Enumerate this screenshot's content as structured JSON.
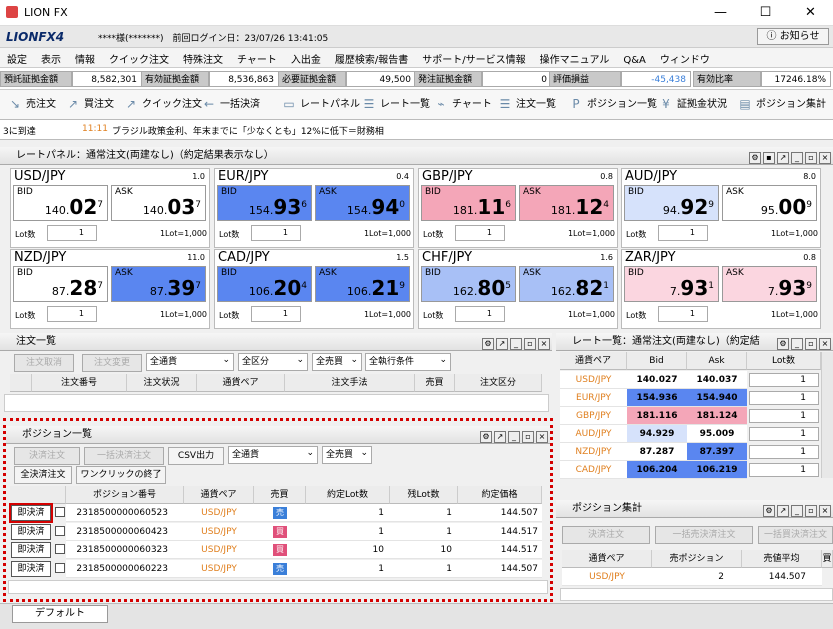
{
  "window": {
    "title": "LION FX"
  },
  "header": {
    "logo": "LIONFX4",
    "user": "****様(*******)　前回ログイン日：23/07/26 13:41:05",
    "notice": "お知らせ"
  },
  "menu": [
    "設定",
    "表示",
    "情報",
    "クイック注文",
    "特殊注文",
    "チャート",
    "入出金",
    "履歴検索/報告書",
    "サポート/サービス情報",
    "操作マニュアル",
    "Q&A",
    "ウィンドウ"
  ],
  "info": [
    {
      "label": "預託証拠金額",
      "value": "8,582,301"
    },
    {
      "label": "有効証拠金額",
      "value": "8,536,863"
    },
    {
      "label": "必要証拠金額",
      "value": "49,500"
    },
    {
      "label": "発注証拠金額",
      "value": "0"
    },
    {
      "label": "評価損益",
      "value": "-45,438"
    },
    {
      "label": "有効比率",
      "value": "17246.18%"
    }
  ],
  "toolbar": [
    "売注文",
    "買注文",
    "クイック注文",
    "一括決済",
    "レートパネル",
    "レート一覧",
    "チャート",
    "注文一覧",
    "ポジション一覧",
    "証拠金状況",
    "ポジション集計"
  ],
  "news": {
    "prefix": "3に到達",
    "time": "11:11",
    "text": "ブラジル政策金利、年末までに「少なくとも」12%に低下＝財務相"
  },
  "rate_panel": {
    "title": "レートパネル：通常注文(両建なし)（約定結果表示なし）",
    "lot_label": "Lot数",
    "lot_value": "1",
    "lot_unit": "1Lot=1,000",
    "bid": "BID",
    "ask": "ASK",
    "pairs": [
      {
        "pair": "USD/JPY",
        "spread": "1.0",
        "bid_a": "140.",
        "bid_b": "02",
        "bid_c": "7",
        "ask_a": "140.",
        "ask_b": "03",
        "ask_c": "7",
        "bid_color": "#ffffff",
        "ask_color": "#ffffff"
      },
      {
        "pair": "EUR/JPY",
        "spread": "0.4",
        "bid_a": "154.",
        "bid_b": "93",
        "bid_c": "6",
        "ask_a": "154.",
        "ask_b": "94",
        "ask_c": "0",
        "bid_color": "#5a86f0",
        "ask_color": "#5a86f0"
      },
      {
        "pair": "GBP/JPY",
        "spread": "0.8",
        "bid_a": "181.",
        "bid_b": "11",
        "bid_c": "6",
        "ask_a": "181.",
        "ask_b": "12",
        "ask_c": "4",
        "bid_color": "#f4a6b8",
        "ask_color": "#f4a6b8"
      },
      {
        "pair": "AUD/JPY",
        "spread": "8.0",
        "bid_a": "94.",
        "bid_b": "92",
        "bid_c": "9",
        "ask_a": "95.",
        "ask_b": "00",
        "ask_c": "9",
        "bid_color": "#d6e2fb",
        "ask_color": "#ffffff"
      },
      {
        "pair": "NZD/JPY",
        "spread": "11.0",
        "bid_a": "87.",
        "bid_b": "28",
        "bid_c": "7",
        "ask_a": "87.",
        "ask_b": "39",
        "ask_c": "7",
        "bid_color": "#ffffff",
        "ask_color": "#5a86f0"
      },
      {
        "pair": "CAD/JPY",
        "spread": "1.5",
        "bid_a": "106.",
        "bid_b": "20",
        "bid_c": "4",
        "ask_a": "106.",
        "ask_b": "21",
        "ask_c": "9",
        "bid_color": "#5a86f0",
        "ask_color": "#5a86f0"
      },
      {
        "pair": "CHF/JPY",
        "spread": "1.6",
        "bid_a": "162.",
        "bid_b": "80",
        "bid_c": "5",
        "ask_a": "162.",
        "ask_b": "82",
        "ask_c": "1",
        "bid_color": "#a8c0f6",
        "ask_color": "#a8c0f6"
      },
      {
        "pair": "ZAR/JPY",
        "spread": "0.8",
        "bid_a": "7.",
        "bid_b": "93",
        "bid_c": "1",
        "ask_a": "7.",
        "ask_b": "93",
        "ask_c": "9",
        "bid_color": "#fbd6e0",
        "ask_color": "#fbd6e0"
      }
    ]
  },
  "order_list": {
    "title": "注文一覧",
    "cancel": "注文取消",
    "change": "注文変更",
    "filters": [
      "全通貨",
      "全区分",
      "全売買",
      "全執行条件"
    ],
    "columns": [
      "注文番号",
      "注文状況",
      "通貨ペア",
      "注文手法",
      "売買",
      "注文区分"
    ]
  },
  "position_list": {
    "title": "ポジション一覧",
    "settle_order": "決済注文",
    "bulk_settle": "一括決済注文",
    "csv": "CSV出力",
    "currency": "全通貨",
    "side": "全売買",
    "all_settle": "全決済注文",
    "one_click_end": "ワンクリックの終了",
    "columns": [
      "ポジション番号",
      "通貨ペア",
      "売買",
      "約定Lot数",
      "残Lot数",
      "約定価格"
    ],
    "settle_btn": "即決済",
    "rows": [
      {
        "id": "2318500000060523",
        "pair": "USD/JPY",
        "side": "売",
        "lot": "1",
        "rest": "1",
        "price": "144.507"
      },
      {
        "id": "2318500000060423",
        "pair": "USD/JPY",
        "side": "買",
        "lot": "1",
        "rest": "1",
        "price": "144.517"
      },
      {
        "id": "2318500000060323",
        "pair": "USD/JPY",
        "side": "買",
        "lot": "10",
        "rest": "10",
        "price": "144.517"
      },
      {
        "id": "2318500000060223",
        "pair": "USD/JPY",
        "side": "売",
        "lot": "1",
        "rest": "1",
        "price": "144.507"
      }
    ]
  },
  "rate_list": {
    "title": "レート一覧：通常注文(両建なし)（約定結",
    "columns": [
      "通貨ペア",
      "Bid",
      "Ask",
      "Lot数"
    ],
    "lot": "1",
    "rows": [
      {
        "pair": "USD/JPY",
        "bid": "140.027",
        "ask": "140.037",
        "bc": "#ffffff",
        "ac": "#ffffff"
      },
      {
        "pair": "EUR/JPY",
        "bid": "154.936",
        "ask": "154.940",
        "bc": "#5a86f0",
        "ac": "#5a86f0"
      },
      {
        "pair": "GBP/JPY",
        "bid": "181.116",
        "ask": "181.124",
        "bc": "#f4a6b8",
        "ac": "#f4a6b8"
      },
      {
        "pair": "AUD/JPY",
        "bid": "94.929",
        "ask": "95.009",
        "bc": "#d6e2fb",
        "ac": "#ffffff"
      },
      {
        "pair": "NZD/JPY",
        "bid": "87.287",
        "ask": "87.397",
        "bc": "#ffffff",
        "ac": "#5a86f0"
      },
      {
        "pair": "CAD/JPY",
        "bid": "106.204",
        "ask": "106.219",
        "bc": "#5a86f0",
        "ac": "#5a86f0"
      }
    ]
  },
  "position_summary": {
    "title": "ポジション集計",
    "settle": "決済注文",
    "bulk_sell": "一括売決済注文",
    "bulk_buy": "一括買決済注文",
    "columns": [
      "通貨ペア",
      "売ポジション",
      "売値平均",
      "買"
    ],
    "row": {
      "pair": "USD/JPY",
      "sell_pos": "2",
      "avg": "144.507"
    }
  },
  "footer_tab": "デフォルト"
}
